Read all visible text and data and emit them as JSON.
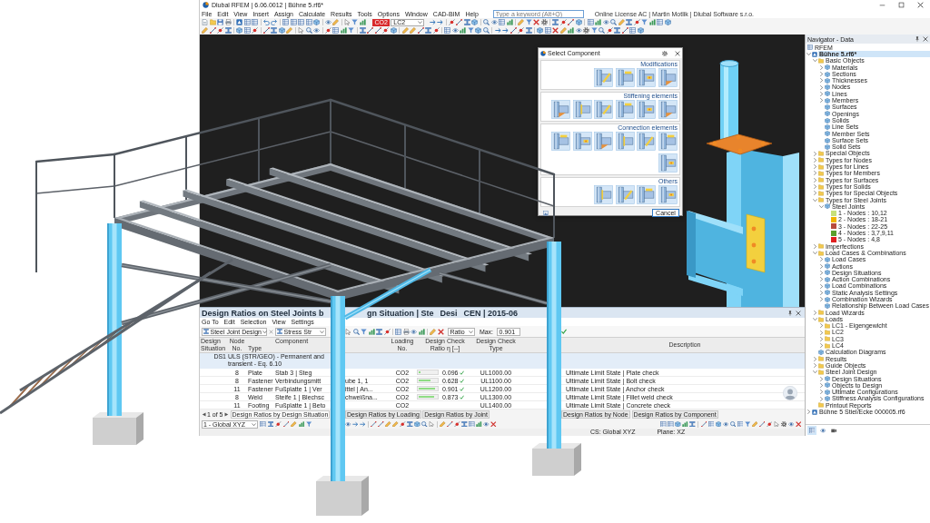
{
  "window": {
    "title": "Dlubal RFEM | 6.06.0012 | Bühne 5.rf6*"
  },
  "menu": [
    "File",
    "Edit",
    "View",
    "Insert",
    "Assign",
    "Calculate",
    "Results",
    "Tools",
    "Options",
    "Window",
    "CAD-BIM",
    "Help"
  ],
  "search": {
    "placeholder": "Type a keyword (Alt+Q)"
  },
  "license": "Online License AC | Martin Motlik | Dlubal Software s.r.o.",
  "load_selector": {
    "badge": "CO2",
    "value": "LC2"
  },
  "navigator": {
    "title": "Navigator - Data",
    "program": "RFEM",
    "tree": [
      {
        "label": "Bühne 5.rf6*",
        "kind": "file",
        "expanded": true,
        "selected": true,
        "children": [
          {
            "label": "Basic Objects",
            "kind": "folder",
            "expanded": true,
            "selected": false,
            "children": [
              {
                "label": "Materials",
                "kind": "object",
                "expanded": false,
                "selected": false
              },
              {
                "label": "Sections",
                "kind": "object",
                "expanded": false,
                "selected": false
              },
              {
                "label": "Thicknesses",
                "kind": "object",
                "expanded": false,
                "selected": false
              },
              {
                "label": "Nodes",
                "kind": "object",
                "expanded": false,
                "selected": false
              },
              {
                "label": "Lines",
                "kind": "object",
                "expanded": false,
                "selected": false
              },
              {
                "label": "Members",
                "kind": "object",
                "expanded": false,
                "selected": false
              },
              {
                "label": "Surfaces",
                "kind": "object",
                "selected": false
              },
              {
                "label": "Openings",
                "kind": "object",
                "selected": false
              },
              {
                "label": "Solids",
                "kind": "object",
                "selected": false
              },
              {
                "label": "Line Sets",
                "kind": "object",
                "selected": false
              },
              {
                "label": "Member Sets",
                "kind": "object",
                "selected": false
              },
              {
                "label": "Surface Sets",
                "kind": "object",
                "selected": false
              },
              {
                "label": "Solid Sets",
                "kind": "object",
                "selected": false
              }
            ]
          },
          {
            "label": "Special Objects",
            "kind": "folder",
            "expanded": false,
            "selected": false
          },
          {
            "label": "Types for Nodes",
            "kind": "folder",
            "expanded": false,
            "selected": false
          },
          {
            "label": "Types for Lines",
            "kind": "folder",
            "expanded": false,
            "selected": false
          },
          {
            "label": "Types for Members",
            "kind": "folder",
            "expanded": false,
            "selected": false
          },
          {
            "label": "Types for Surfaces",
            "kind": "folder",
            "expanded": false,
            "selected": false
          },
          {
            "label": "Types for Solids",
            "kind": "folder",
            "expanded": false,
            "selected": false
          },
          {
            "label": "Types for Special Objects",
            "kind": "folder",
            "expanded": false,
            "selected": false
          },
          {
            "label": "Types for Steel Joints",
            "kind": "folder",
            "expanded": true,
            "selected": false,
            "children": [
              {
                "label": "Steel Joints",
                "kind": "object",
                "expanded": true,
                "selected": false,
                "children": [
                  {
                    "label": "1 - Nodes : 10,12",
                    "kind": "joint",
                    "color": "#c8e07a",
                    "selected": false
                  },
                  {
                    "label": "2 - Nodes : 18-21",
                    "kind": "joint",
                    "color": "#f0b400",
                    "selected": false
                  },
                  {
                    "label": "3 - Nodes : 22-25",
                    "kind": "joint",
                    "color": "#b84a3c",
                    "selected": false
                  },
                  {
                    "label": "4 - Nodes : 3,7,9,11",
                    "kind": "joint",
                    "color": "#5aa02c",
                    "selected": false
                  },
                  {
                    "label": "5 - Nodes : 4,8",
                    "kind": "joint",
                    "color": "#e02020",
                    "selected": false
                  }
                ]
              }
            ]
          },
          {
            "label": "Imperfections",
            "kind": "folder",
            "expanded": false,
            "selected": false
          },
          {
            "label": "Load Cases & Combinations",
            "kind": "folder",
            "expanded": true,
            "selected": false,
            "children": [
              {
                "label": "Load Cases",
                "kind": "object",
                "expanded": false,
                "selected": false
              },
              {
                "label": "Actions",
                "kind": "object",
                "expanded": false,
                "selected": false
              },
              {
                "label": "Design Situations",
                "kind": "object",
                "expanded": false,
                "selected": false
              },
              {
                "label": "Action Combinations",
                "kind": "object",
                "expanded": false,
                "selected": false
              },
              {
                "label": "Load Combinations",
                "kind": "object",
                "expanded": false,
                "selected": false
              },
              {
                "label": "Static Analysis Settings",
                "kind": "object",
                "expanded": false,
                "selected": false
              },
              {
                "label": "Combination Wizards",
                "kind": "object",
                "expanded": false,
                "selected": false
              },
              {
                "label": "Relationship Between Load Cases",
                "kind": "object",
                "selected": false
              }
            ]
          },
          {
            "label": "Load Wizards",
            "kind": "folder",
            "expanded": false,
            "selected": false
          },
          {
            "label": "Loads",
            "kind": "folder",
            "expanded": true,
            "selected": false,
            "children": [
              {
                "label": "LC1 - Eigengewicht",
                "kind": "folder",
                "expanded": false,
                "selected": false
              },
              {
                "label": "LC2",
                "kind": "folder",
                "expanded": false,
                "selected": false
              },
              {
                "label": "LC3",
                "kind": "folder",
                "expanded": false,
                "selected": false
              },
              {
                "label": "LC4",
                "kind": "folder",
                "expanded": false,
                "selected": false
              }
            ]
          },
          {
            "label": "Calculation Diagrams",
            "kind": "object",
            "selected": false
          },
          {
            "label": "Results",
            "kind": "folder",
            "expanded": false,
            "selected": false
          },
          {
            "label": "Guide Objects",
            "kind": "folder",
            "expanded": false,
            "selected": false
          },
          {
            "label": "Steel Joint Design",
            "kind": "folder",
            "expanded": true,
            "selected": false,
            "children": [
              {
                "label": "Design Situations",
                "kind": "object",
                "expanded": false,
                "selected": false
              },
              {
                "label": "Objects to Design",
                "kind": "object",
                "expanded": false,
                "selected": false
              },
              {
                "label": "Ultimate Configurations",
                "kind": "object",
                "expanded": false,
                "selected": false
              },
              {
                "label": "Stiffness Analysis Configurations",
                "kind": "object",
                "expanded": false,
                "selected": false
              }
            ]
          },
          {
            "label": "Printout Reports",
            "kind": "folder",
            "selected": false
          }
        ]
      },
      {
        "label": "Bühne 5 Stiel/Ecke 000005.rf6",
        "kind": "file",
        "expanded": false,
        "selected": false
      }
    ],
    "tabs": [
      {
        "selected": true
      },
      {
        "selected": false
      },
      {
        "selected": false
      }
    ]
  },
  "dialog": {
    "title": "Select Component",
    "sections": [
      {
        "label": "Modifications"
      },
      {
        "label": "Stiffening elements"
      },
      {
        "label": "Connection elements"
      },
      {
        "label": "Others"
      }
    ],
    "cancel": "Cancel"
  },
  "results_panel": {
    "title_parts": [
      "Design Ratios on Steel Joints b",
      "gn Situation | Ste",
      "Desi",
      "CEN | 2015-06"
    ],
    "menu": [
      "Go To",
      "Edit",
      "Selection",
      "View",
      "Settings"
    ],
    "module_select": "Steel Joint Design",
    "result_select": "Stress Str",
    "filter_select": "Ratio",
    "max_label": "Max:",
    "max_value": "0.901",
    "columns": [
      {
        "label": "Design\nSituation"
      },
      {
        "label": "Node\nNo."
      },
      {
        "label": "Type"
      },
      {
        "label": "Component"
      },
      {
        "label": "Loading\nNo."
      },
      {
        "label": "Design Check\nRatio η [--]"
      },
      {
        "label": "Design Check\nType"
      },
      {
        "label": "Description"
      }
    ],
    "group": {
      "situation": "DS1",
      "label": "ULS (STR/GEO) - Permanent and transient - Eq. 6.10"
    },
    "rows": [
      {
        "node": "8",
        "type": "Plate",
        "component": "Stab 3 | Steg",
        "loading": "CO2",
        "level": 0.096,
        "ratio": "0.096",
        "check": "UL1000.00",
        "description": "Ultimate Limit State | Plate check"
      },
      {
        "node": "8",
        "type": "Fastener",
        "component": "Verbindungsmitt",
        "component_rest": "ube 1, 1",
        "loading": "CO2",
        "level": 0.628,
        "ratio": "0.628",
        "check": "UL1100.00",
        "description": "Ultimate Limit State | Bolt check"
      },
      {
        "node": "11",
        "type": "Fastener",
        "component": "Fußplatte 1 | Ver",
        "component_rest": "ittel | An...",
        "loading": "CO2",
        "level": 0.901,
        "ratio": "0.901",
        "check": "UL1200.00",
        "description": "Ultimate Limit State | Anchor check"
      },
      {
        "node": "8",
        "type": "Weld",
        "component": "Steife 1 | Blechsc",
        "component_rest": "chweißna...",
        "loading": "CO2",
        "level": 0.873,
        "ratio": "0.873",
        "check": "UL1300.00",
        "description": "Ultimate Limit State | Fillet weld check"
      },
      {
        "node": "11",
        "type": "Footing",
        "component": "Fußplatte 1 | Beto",
        "loading": "CO2",
        "check": "UL1400.00",
        "description": "Ultimate Limit State | Concrete check"
      }
    ],
    "pager": "1 of 5",
    "tabs": [
      {
        "label": "Design Ratios by Design Situation",
        "selected": true
      },
      {
        "label": "Design Ratios by Loading",
        "selected": false
      },
      {
        "label": "Design Ratios by Joint",
        "selected": false
      },
      {
        "label": "Design Ratios by Node",
        "selected": false
      },
      {
        "label": "Design Ratios by Component",
        "selected": false
      }
    ],
    "view_select": "1 - Global XYZ",
    "status": [
      "CS: Global XYZ",
      "Plane: XZ"
    ]
  }
}
